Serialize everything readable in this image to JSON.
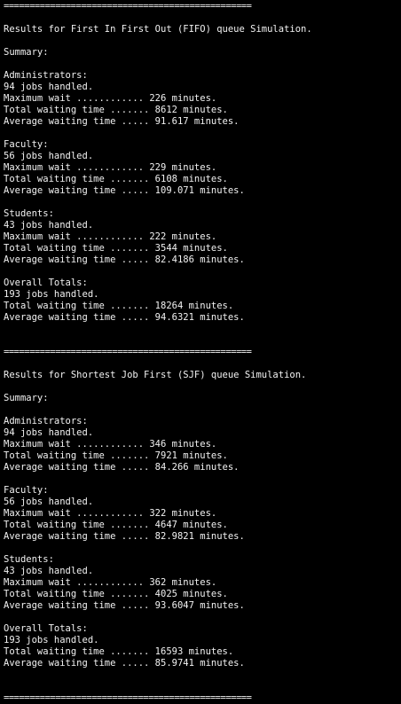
{
  "separator": "================================================",
  "fifo": {
    "heading": "Results for First In First Out (FIFO) queue Simulation.",
    "summary": "Summary:",
    "administrators": {
      "title": "Administrators:",
      "jobs": "94 jobs handled.",
      "max": "Maximum wait ............ 226 minutes.",
      "total": "Total waiting time ....... 8612 minutes.",
      "avg": "Average waiting time ..... 91.617 minutes."
    },
    "faculty": {
      "title": "Faculty:",
      "jobs": "56 jobs handled.",
      "max": "Maximum wait ............ 229 minutes.",
      "total": "Total waiting time ....... 6108 minutes.",
      "avg": "Average waiting time ..... 109.071 minutes."
    },
    "students": {
      "title": "Students:",
      "jobs": "43 jobs handled.",
      "max": "Maximum wait ............ 222 minutes.",
      "total": "Total waiting time ....... 3544 minutes.",
      "avg": "Average waiting time ..... 82.4186 minutes."
    },
    "overall": {
      "title": "Overall Totals:",
      "jobs": "193 jobs handled.",
      "total": "Total waiting time ....... 18264 minutes.",
      "avg": "Average waiting time ..... 94.6321 minutes."
    }
  },
  "sjf": {
    "heading": "Results for Shortest Job First (SJF) queue Simulation.",
    "summary": "Summary:",
    "administrators": {
      "title": "Administrators:",
      "jobs": "94 jobs handled.",
      "max": "Maximum wait ............ 346 minutes.",
      "total": "Total waiting time ....... 7921 minutes.",
      "avg": "Average waiting time ..... 84.266 minutes."
    },
    "faculty": {
      "title": "Faculty:",
      "jobs": "56 jobs handled.",
      "max": "Maximum wait ............ 322 minutes.",
      "total": "Total waiting time ....... 4647 minutes.",
      "avg": "Average waiting time ..... 82.9821 minutes."
    },
    "students": {
      "title": "Students:",
      "jobs": "43 jobs handled.",
      "max": "Maximum wait ............ 362 minutes.",
      "total": "Total waiting time ....... 4025 minutes.",
      "avg": "Average waiting time ..... 93.6047 minutes."
    },
    "overall": {
      "title": "Overall Totals:",
      "jobs": "193 jobs handled.",
      "total": "Total waiting time ....... 16593 minutes.",
      "avg": "Average waiting time ..... 85.9741 minutes."
    }
  }
}
